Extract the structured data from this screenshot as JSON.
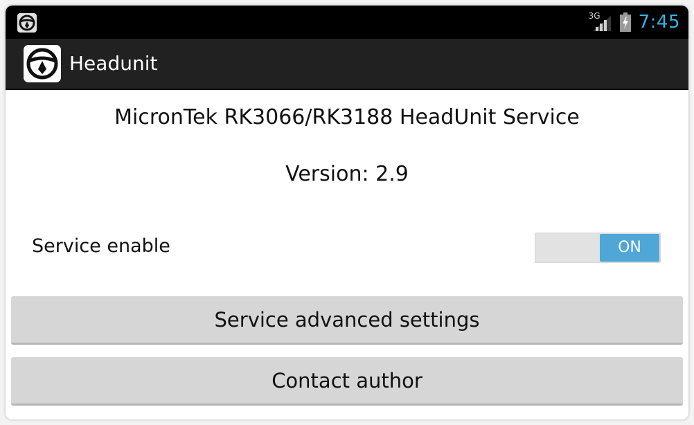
{
  "status_bar": {
    "network_type": "3G",
    "time": "7:45",
    "icons": [
      "steering-wheel-icon",
      "signal-icon",
      "battery-charging-icon"
    ]
  },
  "action_bar": {
    "title": "Headunit",
    "icon": "steering-wheel-icon"
  },
  "main": {
    "heading": "MicronTek RK3066/RK3188 HeadUnit Service",
    "version": "Version: 2.9",
    "service_enable": {
      "label": "Service enable",
      "state_label": "ON",
      "on": true
    },
    "buttons": {
      "advanced_label": "Service advanced settings",
      "contact_label": "Contact author"
    }
  },
  "colors": {
    "status_bar_bg": "#000000",
    "action_bar_bg": "#212121",
    "clock": "#33b5e5",
    "toggle_on": "#4fa7d8",
    "button_bg": "#d6d6d6"
  }
}
